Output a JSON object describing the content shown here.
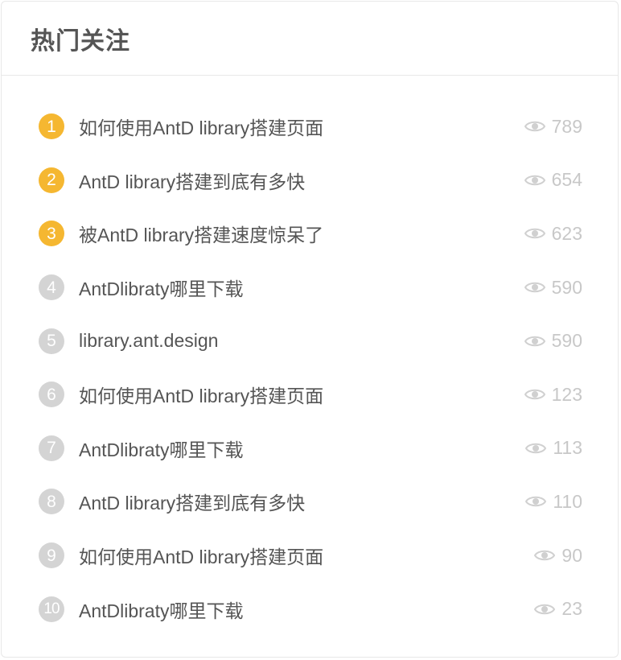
{
  "card": {
    "title": "热门关注"
  },
  "items": [
    {
      "rank": "1",
      "title": "如何使用AntD library搭建页面",
      "views": "789"
    },
    {
      "rank": "2",
      "title": "AntD library搭建到底有多快",
      "views": "654"
    },
    {
      "rank": "3",
      "title": "被AntD library搭建速度惊呆了",
      "views": "623"
    },
    {
      "rank": "4",
      "title": "AntDlibraty哪里下载",
      "views": "590"
    },
    {
      "rank": "5",
      "title": "library.ant.design",
      "views": "590"
    },
    {
      "rank": "6",
      "title": "如何使用AntD library搭建页面",
      "views": "123"
    },
    {
      "rank": "7",
      "title": "AntDlibraty哪里下载",
      "views": "113"
    },
    {
      "rank": "8",
      "title": "AntD library搭建到底有多快",
      "views": "110"
    },
    {
      "rank": "9",
      "title": "如何使用AntD library搭建页面",
      "views": "90"
    },
    {
      "rank": "10",
      "title": "AntDlibraty哪里下载",
      "views": "23"
    }
  ],
  "colors": {
    "top_rank": "#f5b731",
    "other_rank": "#d4d4d4",
    "view_text": "#c8c8c8"
  },
  "icons": {
    "views": "eye-icon"
  }
}
